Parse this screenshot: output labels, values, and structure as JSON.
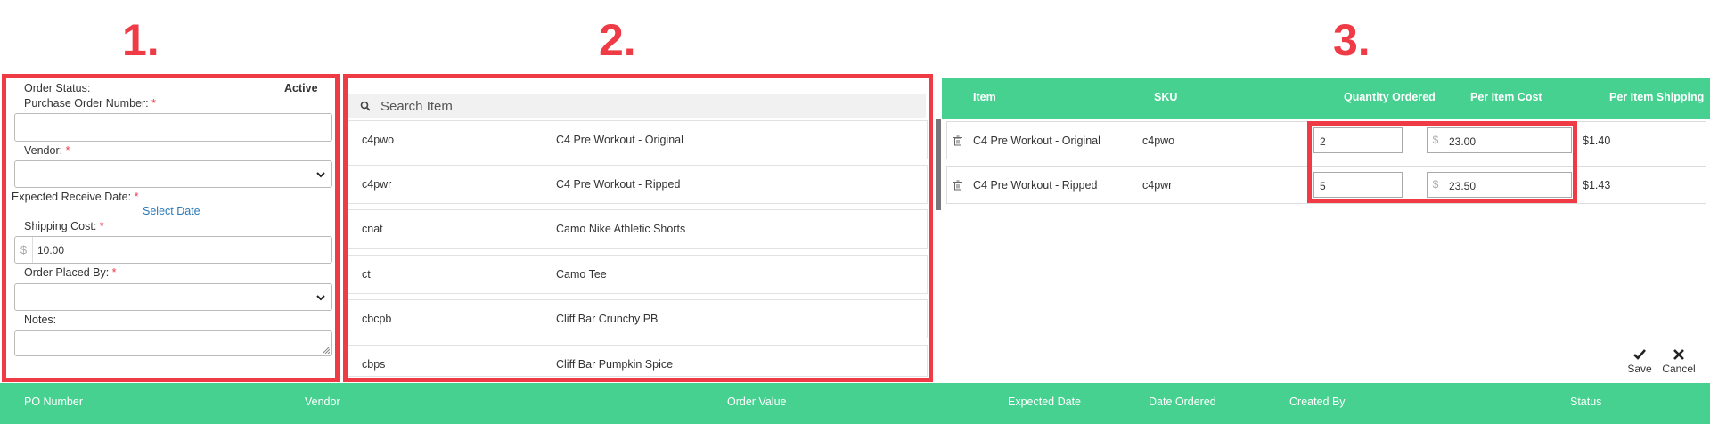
{
  "steps": [
    "1.",
    "2.",
    "3."
  ],
  "form": {
    "order_status_label": "Order Status:",
    "order_status_value": "Active",
    "po_number_label": "Purchase Order Number:",
    "vendor_label": "Vendor:",
    "expected_date_label": "Expected Receive Date:",
    "select_date": "Select Date",
    "shipping_label": "Shipping Cost:",
    "currency": "$",
    "shipping_value": "10.00",
    "placed_by_label": "Order Placed By:",
    "notes_label": "Notes:",
    "required_mark": "*"
  },
  "search": {
    "placeholder": "Search Item",
    "items": [
      {
        "sku": "c4pwo",
        "name": "C4 Pre Workout - Original"
      },
      {
        "sku": "c4pwr",
        "name": "C4 Pre Workout - Ripped"
      },
      {
        "sku": "cnat",
        "name": "Camo Nike Athletic Shorts"
      },
      {
        "sku": "ct",
        "name": "Camo Tee"
      },
      {
        "sku": "cbcpb",
        "name": "Cliff Bar Crunchy PB"
      },
      {
        "sku": "cbps",
        "name": "Cliff Bar Pumpkin Spice"
      }
    ]
  },
  "order_table": {
    "headers": {
      "item": "Item",
      "sku": "SKU",
      "qty": "Quantity Ordered",
      "cost": "Per Item Cost",
      "shipping": "Per Item Shipping"
    },
    "rows": [
      {
        "item": "C4 Pre Workout - Original",
        "sku": "c4pwo",
        "qty": "2",
        "cost": "23.00",
        "shipping": "$1.40"
      },
      {
        "item": "C4 Pre Workout - Ripped",
        "sku": "c4pwr",
        "qty": "5",
        "cost": "23.50",
        "shipping": "$1.43"
      }
    ],
    "save": "Save",
    "cancel": "Cancel"
  },
  "po_list": {
    "headers": {
      "po_number": "PO Number",
      "vendor": "Vendor",
      "order_value": "Order Value",
      "expected_date": "Expected Date",
      "date_ordered": "Date Ordered",
      "created_by": "Created By",
      "status": "Status"
    }
  },
  "colors": {
    "accent_green": "#47d191",
    "annotation_red": "#ee3b46",
    "link_blue": "#2a7ab8"
  }
}
